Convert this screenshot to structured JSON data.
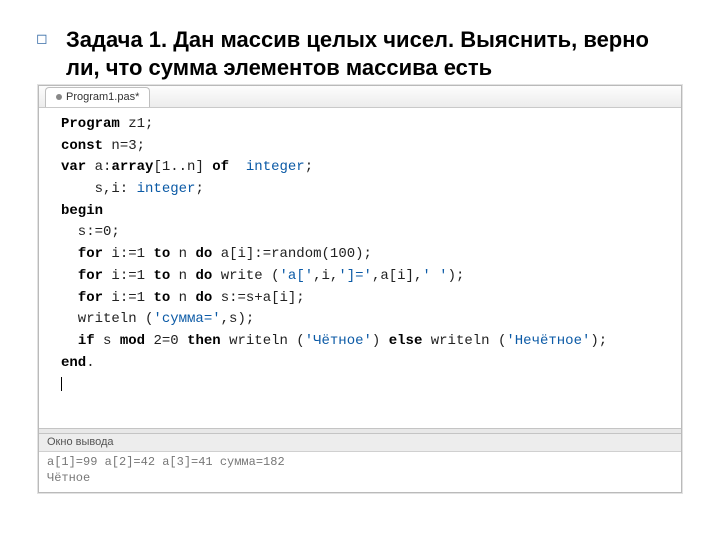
{
  "task": {
    "bullet": "◻",
    "text": "Задача 1. Дан массив целых чисел. Выяснить, верно ли, что сумма элементов массива есть"
  },
  "tab": {
    "label": "Program1.pas*"
  },
  "code": {
    "l1_kw": "Program",
    "l1_rest": " z1;",
    "l2_kw": "const",
    "l2_rest": " n=3;",
    "l3_kw": "var",
    "l3_a": " a:",
    "l3_arr": "array",
    "l3_idx": "[1..n] ",
    "l3_of": "of",
    "l3_sp": "  ",
    "l3_int": "integer",
    "l3_semi": ";",
    "l4_pad": "    s,i: ",
    "l4_int": "integer",
    "l4_semi": ";",
    "l5_kw": "begin",
    "l6": "  s:=0;",
    "l7_pad": "  ",
    "l7_for": "for",
    "l7_a": " i:=1 ",
    "l7_to": "to",
    "l7_b": " n ",
    "l7_do": "do",
    "l7_c": " a[i]:=random(100);",
    "l8_pad": "  ",
    "l8_for": "for",
    "l8_a": " i:=1 ",
    "l8_to": "to",
    "l8_b": " n ",
    "l8_do": "do",
    "l8_c1": " write (",
    "l8_s1": "'a['",
    "l8_c2": ",i,",
    "l8_s2": "']='",
    "l8_c3": ",a[i],",
    "l8_s3": "' '",
    "l8_c4": ");",
    "l9_pad": "  ",
    "l9_for": "for",
    "l9_a": " i:=1 ",
    "l9_to": "to",
    "l9_b": " n ",
    "l9_do": "do",
    "l9_c": " s:=s+a[i];",
    "l10_a": "  writeln (",
    "l10_s": "'сумма='",
    "l10_b": ",s);",
    "l11_pad": "  ",
    "l11_if": "if",
    "l11_a": " s ",
    "l11_mod": "mod",
    "l11_b": " 2=0 ",
    "l11_then": "then",
    "l11_c": " writeln (",
    "l11_s1": "'Чётное'",
    "l11_d": ") ",
    "l11_else": "else",
    "l11_e": " writeln (",
    "l11_s2": "'Нечётное'",
    "l11_f": ");",
    "l12_kw": "end",
    "l12_dot": "."
  },
  "output": {
    "header": "Окно вывода",
    "line1": "a[1]=99 a[2]=42 a[3]=41 сумма=182",
    "line2": "Чётное"
  }
}
